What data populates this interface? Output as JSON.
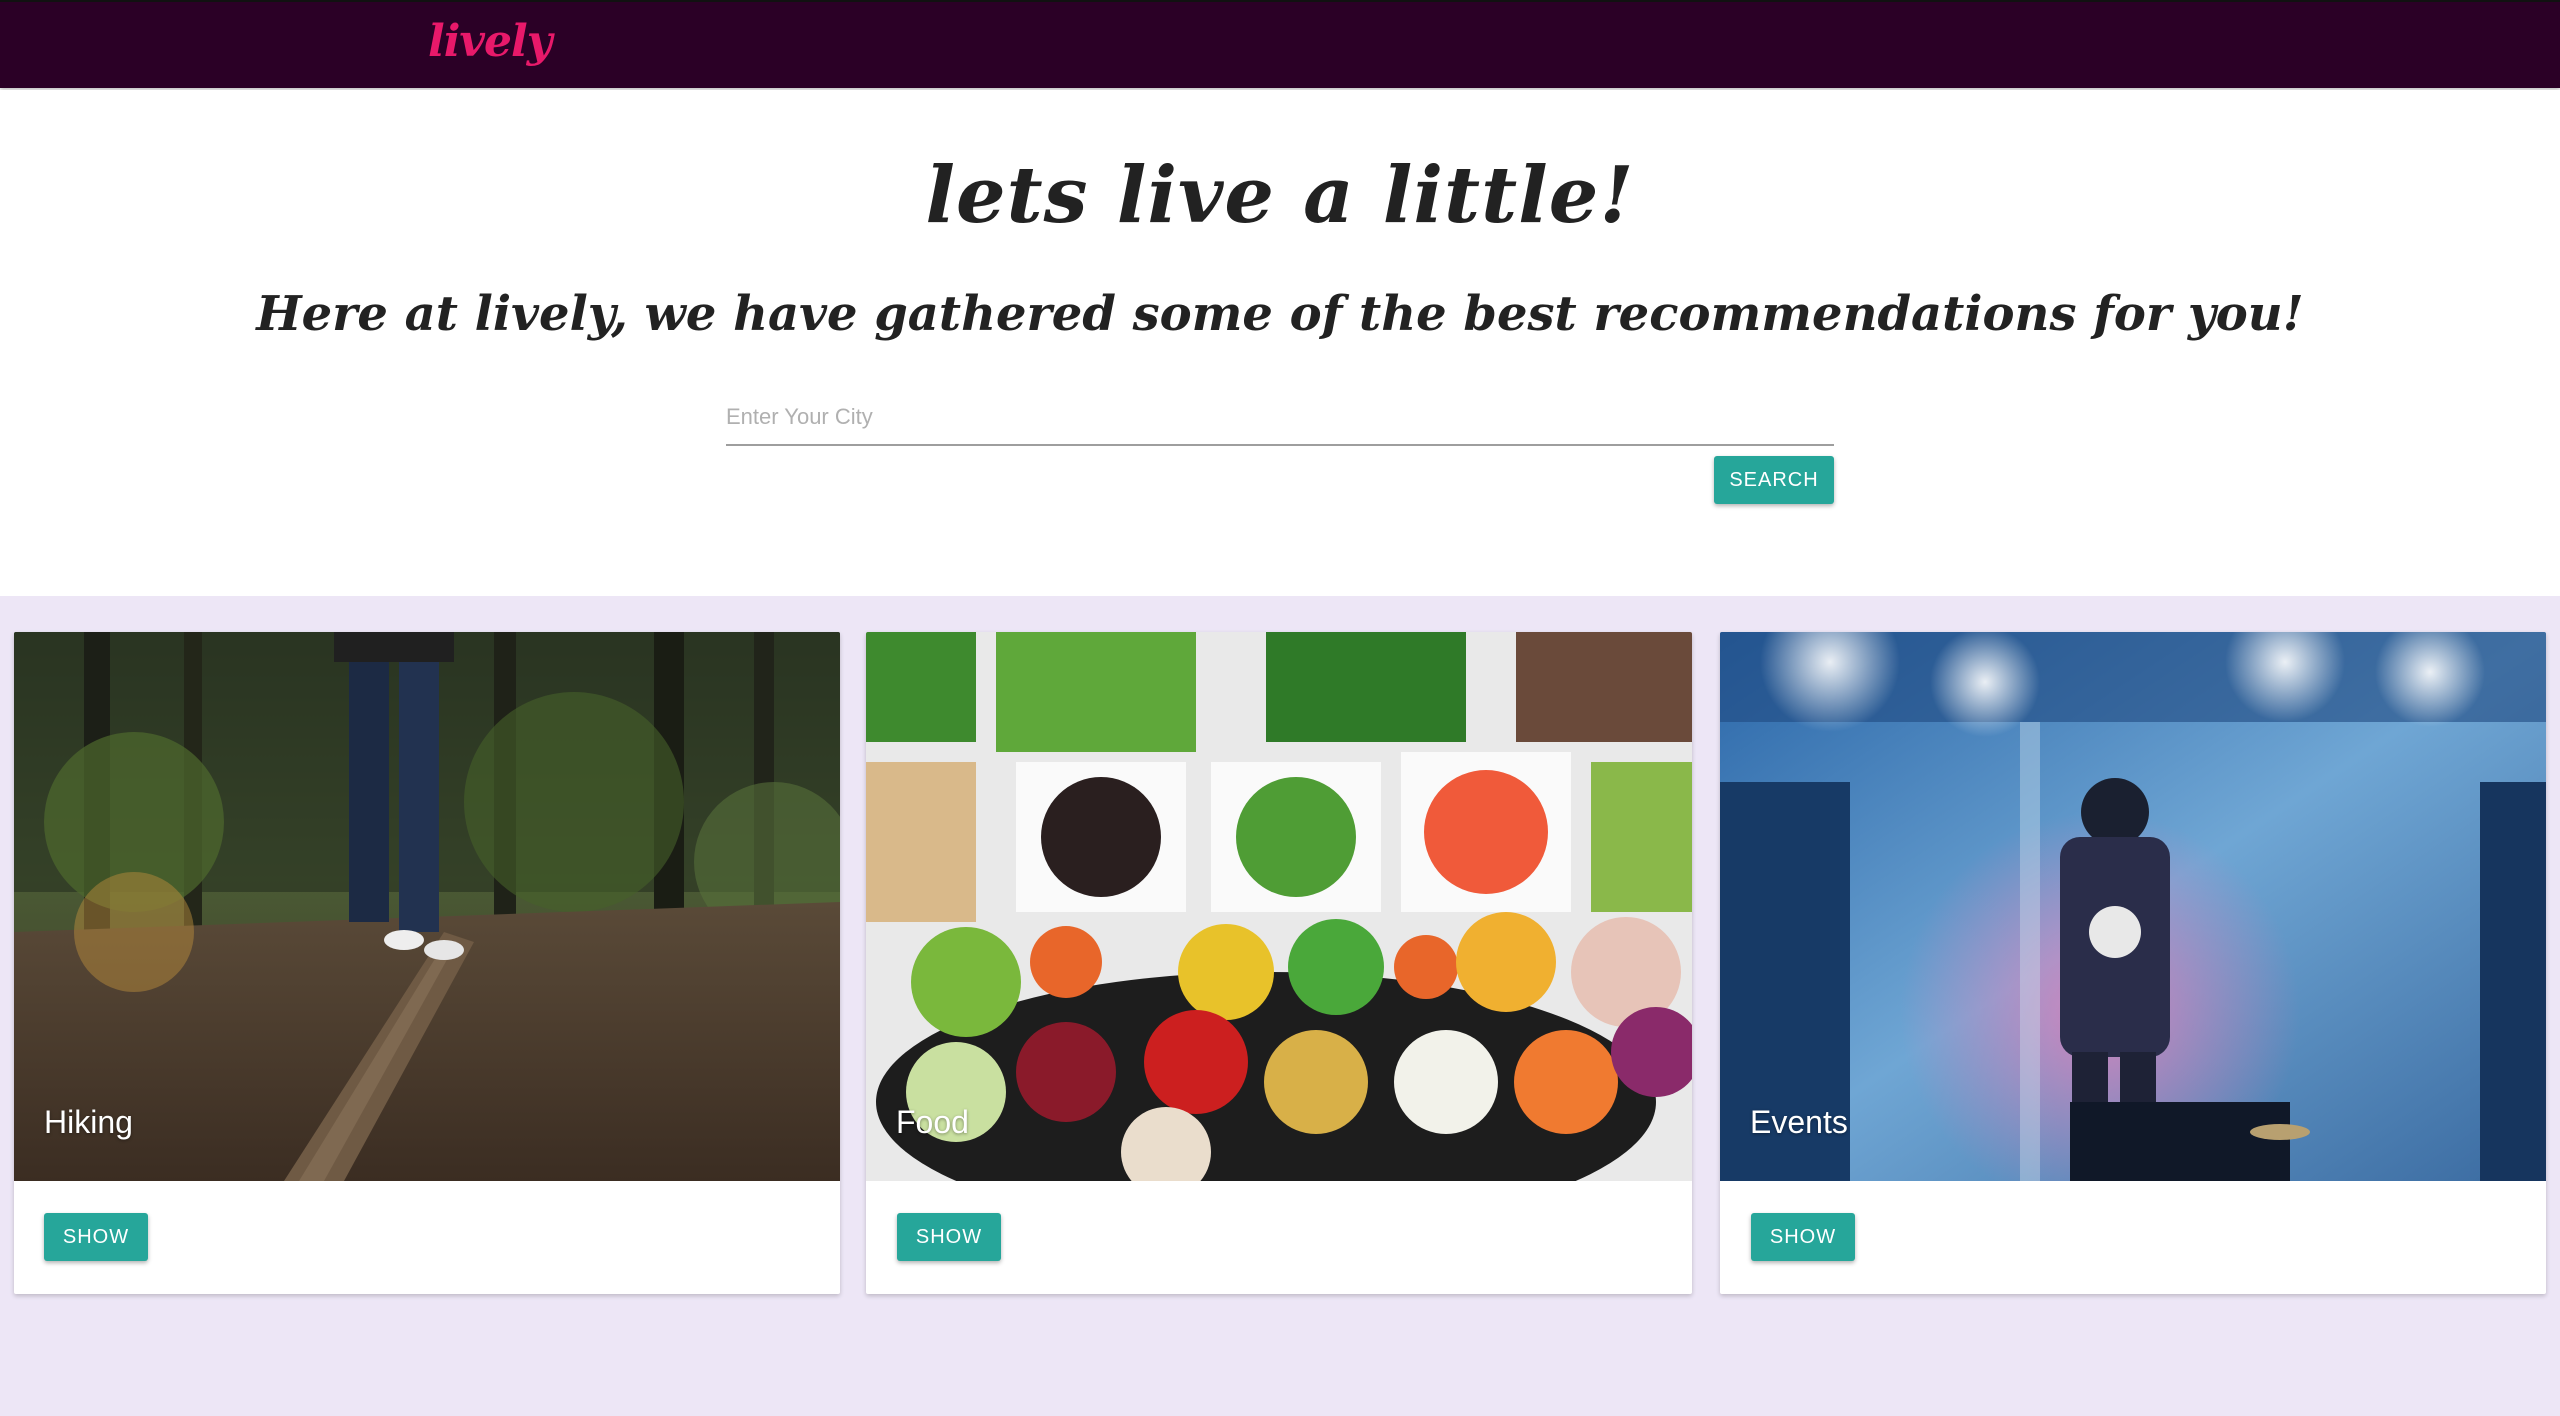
{
  "navbar": {
    "brand": "lively",
    "brand_color": "#e8196a",
    "background": "#2b0026"
  },
  "hero": {
    "title": "lets live a little!",
    "subtitle": "Here at lively, we have gathered some of the best recommendations for you!"
  },
  "search": {
    "placeholder": "Enter Your City",
    "value": "",
    "button_label": "SEARCH"
  },
  "accent_color": "#26a69a",
  "section_background": "#ede6f6",
  "cards": [
    {
      "title": "Hiking",
      "image": "forest-trail-photo",
      "button_label": "SHOW"
    },
    {
      "title": "Food",
      "image": "salad-bar-photo",
      "button_label": "SHOW"
    },
    {
      "title": "Events",
      "image": "concert-stage-photo",
      "button_label": "SHOW"
    }
  ]
}
